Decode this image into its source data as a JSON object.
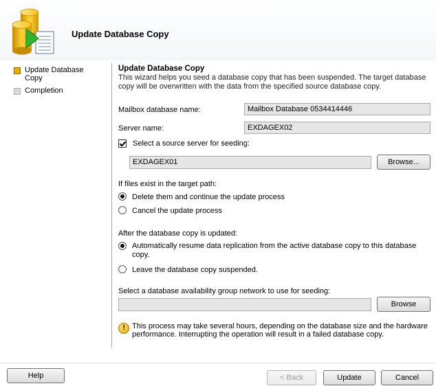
{
  "header": {
    "title": "Update Database Copy"
  },
  "nav": {
    "items": [
      {
        "label": "Update Database Copy",
        "state": "active"
      },
      {
        "label": "Completion",
        "state": "inactive"
      }
    ]
  },
  "main": {
    "section_title": "Update Database Copy",
    "description": "This wizard helps you seed a database copy that has been suspended. The target database copy will be overwritten with the data from the specified source database copy.",
    "mailbox_db_label": "Mailbox database name:",
    "mailbox_db_value": "Mailbox Database 0534414446",
    "server_label": "Server name:",
    "server_value": "EXDAGEX02",
    "source_checkbox_label": "Select a source server for seeding:",
    "source_checked": true,
    "source_server_value": "EXDAGEX01",
    "browse_label": "Browse...",
    "files_exist_label": "If files exist in the target path:",
    "files_options": [
      {
        "label": "Delete them and continue the update process",
        "selected": true
      },
      {
        "label": "Cancel the update process",
        "selected": false
      }
    ],
    "after_update_label": "After the database copy is updated:",
    "after_options": [
      {
        "label": "Automatically resume data replication from the active database copy to this database copy.",
        "selected": true
      },
      {
        "label": "Leave the database copy suspended.",
        "selected": false
      }
    ],
    "network_label": "Select a database availability group network to use for seeding:",
    "network_value": "",
    "network_browse_label": "Browse",
    "warning_text": "This process may take several hours, depending on the database size and the hardware performance. Interrupting the operation will result in a failed database copy."
  },
  "footer": {
    "help_label": "Help",
    "back_label": "< Back",
    "update_label": "Update",
    "cancel_label": "Cancel"
  },
  "icons": {
    "header_logo": "database-wizard-icon",
    "warning": "warning-icon"
  }
}
